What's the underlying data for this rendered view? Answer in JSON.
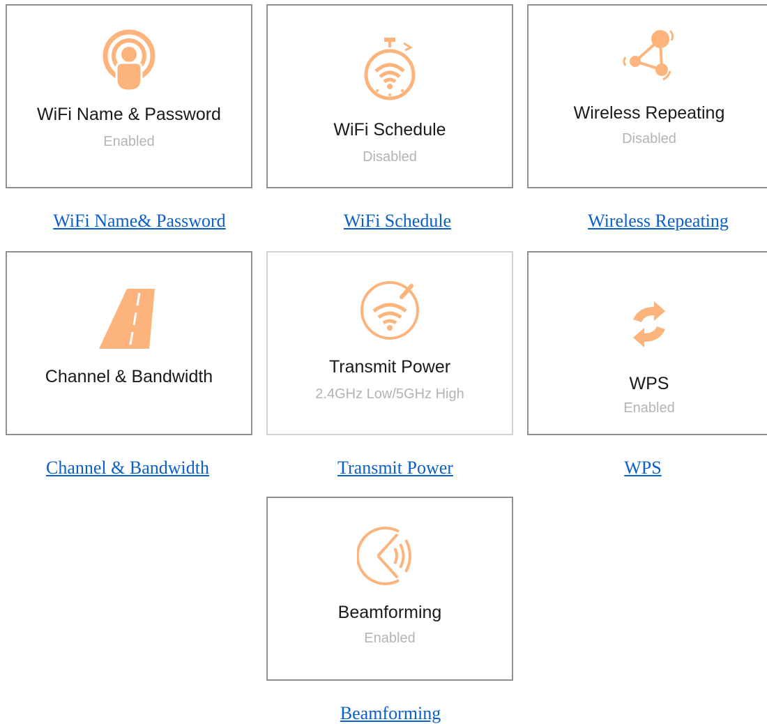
{
  "accent_color": "#fdb47c",
  "tiles": [
    {
      "id": "wifi-name",
      "icon": "wifi-hotspot-person-icon",
      "title": "WiFi Name & Password",
      "status": "Enabled",
      "link": "WiFi Name& Password"
    },
    {
      "id": "wifi-schedule",
      "icon": "stopwatch-wifi-icon",
      "title": "WiFi Schedule",
      "status": "Disabled",
      "link": "WiFi Schedule"
    },
    {
      "id": "wireless-repeating",
      "icon": "repeater-triangle-icon",
      "title": "Wireless Repeating",
      "status": "Disabled",
      "link": "Wireless Repeating"
    },
    {
      "id": "channel-bandwidth",
      "icon": "road-icon",
      "title": "Channel & Bandwidth",
      "status": "",
      "link": "Channel & Bandwidth"
    },
    {
      "id": "transmit-power",
      "icon": "wifi-gauge-icon",
      "title": "Transmit Power",
      "status": "2.4GHz Low/5GHz High",
      "link": "Transmit Power"
    },
    {
      "id": "wps",
      "icon": "sync-arrows-icon",
      "title": "WPS",
      "status": "Enabled",
      "link": "WPS"
    },
    {
      "id": "beamforming",
      "icon": "beam-signal-icon",
      "title": "Beamforming",
      "status": "Enabled",
      "link": "Beamforming"
    }
  ]
}
